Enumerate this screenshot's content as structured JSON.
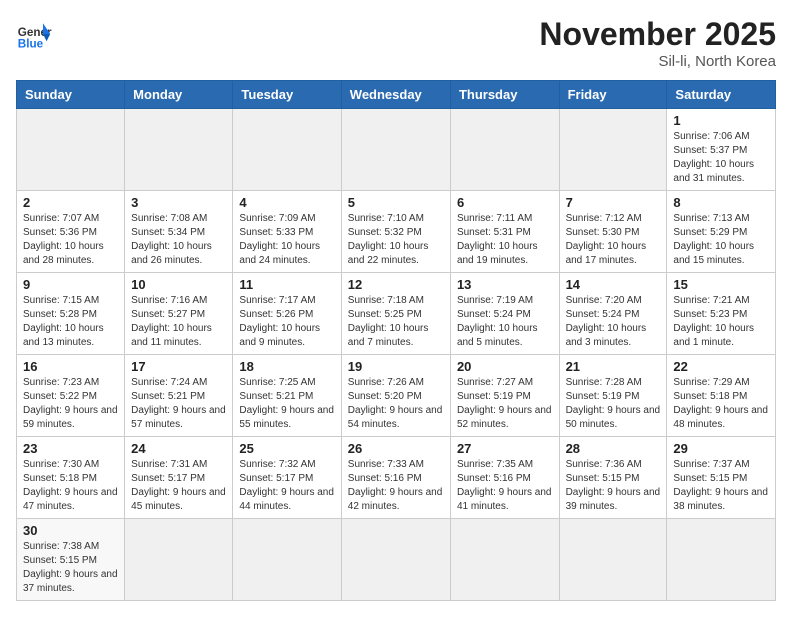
{
  "logo": {
    "general": "General",
    "blue": "Blue"
  },
  "header": {
    "month": "November 2025",
    "location": "Sil-li, North Korea"
  },
  "weekdays": [
    "Sunday",
    "Monday",
    "Tuesday",
    "Wednesday",
    "Thursday",
    "Friday",
    "Saturday"
  ],
  "days": [
    {
      "num": "",
      "empty": true
    },
    {
      "num": "",
      "empty": true
    },
    {
      "num": "",
      "empty": true
    },
    {
      "num": "",
      "empty": true
    },
    {
      "num": "",
      "empty": true
    },
    {
      "num": "",
      "empty": true
    },
    {
      "num": "1",
      "sunrise": "7:06 AM",
      "sunset": "5:37 PM",
      "daylight": "10 hours and 31 minutes."
    },
    {
      "num": "2",
      "sunrise": "7:07 AM",
      "sunset": "5:36 PM",
      "daylight": "10 hours and 28 minutes."
    },
    {
      "num": "3",
      "sunrise": "7:08 AM",
      "sunset": "5:34 PM",
      "daylight": "10 hours and 26 minutes."
    },
    {
      "num": "4",
      "sunrise": "7:09 AM",
      "sunset": "5:33 PM",
      "daylight": "10 hours and 24 minutes."
    },
    {
      "num": "5",
      "sunrise": "7:10 AM",
      "sunset": "5:32 PM",
      "daylight": "10 hours and 22 minutes."
    },
    {
      "num": "6",
      "sunrise": "7:11 AM",
      "sunset": "5:31 PM",
      "daylight": "10 hours and 19 minutes."
    },
    {
      "num": "7",
      "sunrise": "7:12 AM",
      "sunset": "5:30 PM",
      "daylight": "10 hours and 17 minutes."
    },
    {
      "num": "8",
      "sunrise": "7:13 AM",
      "sunset": "5:29 PM",
      "daylight": "10 hours and 15 minutes."
    },
    {
      "num": "9",
      "sunrise": "7:15 AM",
      "sunset": "5:28 PM",
      "daylight": "10 hours and 13 minutes."
    },
    {
      "num": "10",
      "sunrise": "7:16 AM",
      "sunset": "5:27 PM",
      "daylight": "10 hours and 11 minutes."
    },
    {
      "num": "11",
      "sunrise": "7:17 AM",
      "sunset": "5:26 PM",
      "daylight": "10 hours and 9 minutes."
    },
    {
      "num": "12",
      "sunrise": "7:18 AM",
      "sunset": "5:25 PM",
      "daylight": "10 hours and 7 minutes."
    },
    {
      "num": "13",
      "sunrise": "7:19 AM",
      "sunset": "5:24 PM",
      "daylight": "10 hours and 5 minutes."
    },
    {
      "num": "14",
      "sunrise": "7:20 AM",
      "sunset": "5:24 PM",
      "daylight": "10 hours and 3 minutes."
    },
    {
      "num": "15",
      "sunrise": "7:21 AM",
      "sunset": "5:23 PM",
      "daylight": "10 hours and 1 minute."
    },
    {
      "num": "16",
      "sunrise": "7:23 AM",
      "sunset": "5:22 PM",
      "daylight": "9 hours and 59 minutes."
    },
    {
      "num": "17",
      "sunrise": "7:24 AM",
      "sunset": "5:21 PM",
      "daylight": "9 hours and 57 minutes."
    },
    {
      "num": "18",
      "sunrise": "7:25 AM",
      "sunset": "5:21 PM",
      "daylight": "9 hours and 55 minutes."
    },
    {
      "num": "19",
      "sunrise": "7:26 AM",
      "sunset": "5:20 PM",
      "daylight": "9 hours and 54 minutes."
    },
    {
      "num": "20",
      "sunrise": "7:27 AM",
      "sunset": "5:19 PM",
      "daylight": "9 hours and 52 minutes."
    },
    {
      "num": "21",
      "sunrise": "7:28 AM",
      "sunset": "5:19 PM",
      "daylight": "9 hours and 50 minutes."
    },
    {
      "num": "22",
      "sunrise": "7:29 AM",
      "sunset": "5:18 PM",
      "daylight": "9 hours and 48 minutes."
    },
    {
      "num": "23",
      "sunrise": "7:30 AM",
      "sunset": "5:18 PM",
      "daylight": "9 hours and 47 minutes."
    },
    {
      "num": "24",
      "sunrise": "7:31 AM",
      "sunset": "5:17 PM",
      "daylight": "9 hours and 45 minutes."
    },
    {
      "num": "25",
      "sunrise": "7:32 AM",
      "sunset": "5:17 PM",
      "daylight": "9 hours and 44 minutes."
    },
    {
      "num": "26",
      "sunrise": "7:33 AM",
      "sunset": "5:16 PM",
      "daylight": "9 hours and 42 minutes."
    },
    {
      "num": "27",
      "sunrise": "7:35 AM",
      "sunset": "5:16 PM",
      "daylight": "9 hours and 41 minutes."
    },
    {
      "num": "28",
      "sunrise": "7:36 AM",
      "sunset": "5:15 PM",
      "daylight": "9 hours and 39 minutes."
    },
    {
      "num": "29",
      "sunrise": "7:37 AM",
      "sunset": "5:15 PM",
      "daylight": "9 hours and 38 minutes."
    },
    {
      "num": "30",
      "sunrise": "7:38 AM",
      "sunset": "5:15 PM",
      "daylight": "9 hours and 37 minutes."
    },
    {
      "num": "",
      "empty": true
    },
    {
      "num": "",
      "empty": true
    },
    {
      "num": "",
      "empty": true
    },
    {
      "num": "",
      "empty": true
    },
    {
      "num": "",
      "empty": true
    },
    {
      "num": "",
      "empty": true
    }
  ]
}
